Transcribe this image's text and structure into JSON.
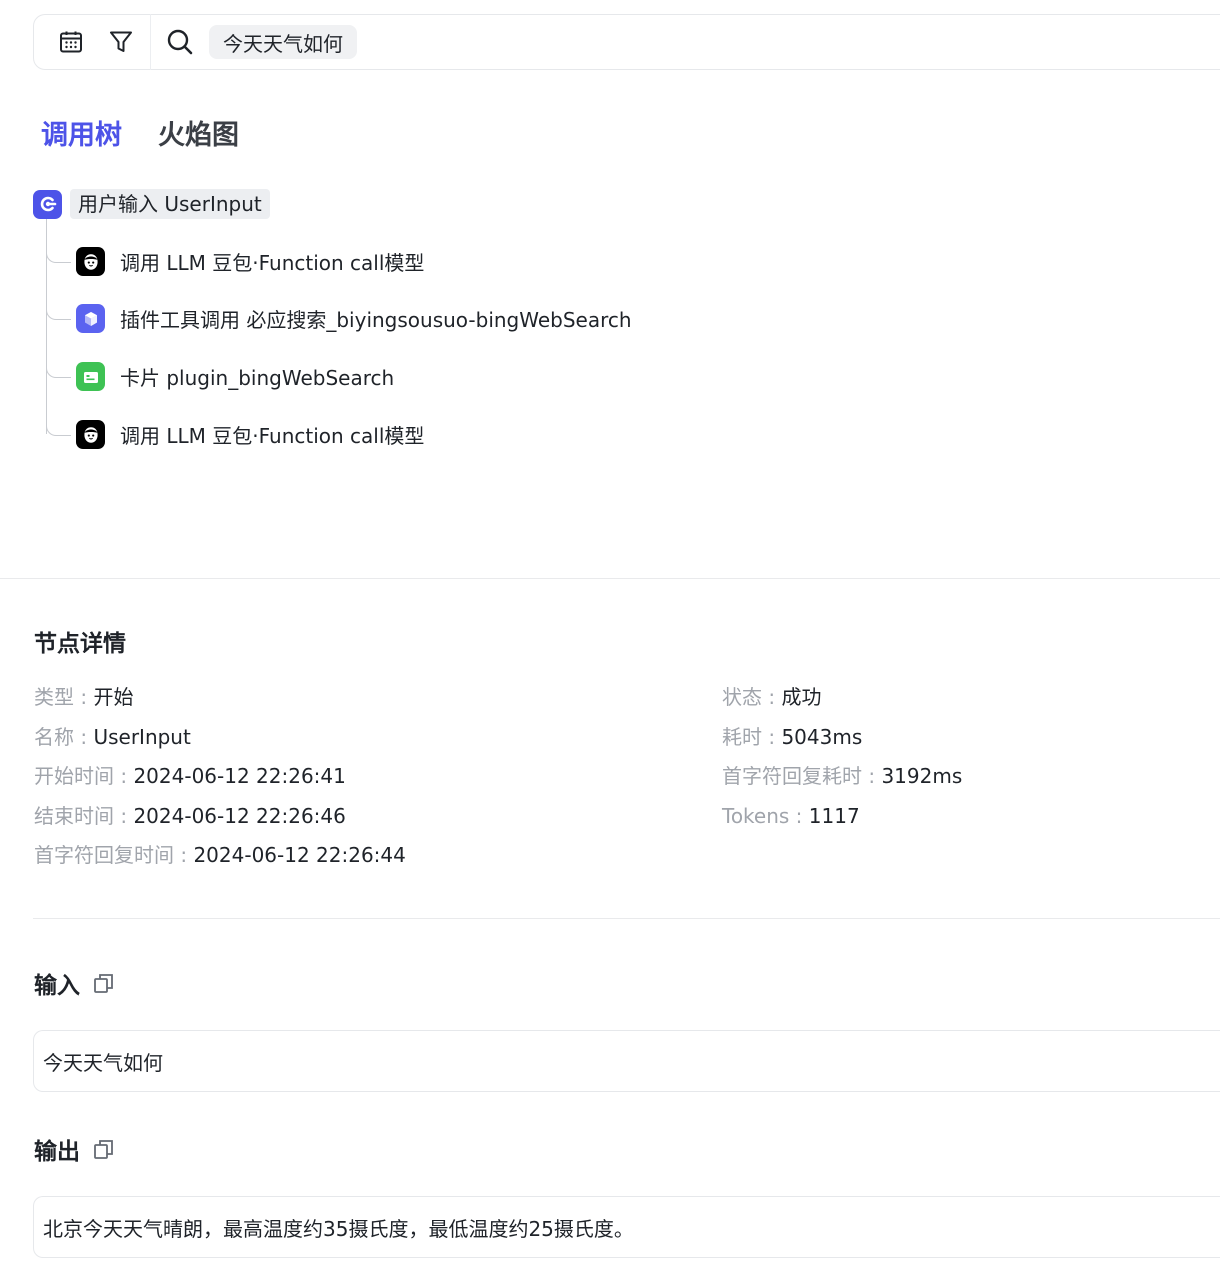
{
  "toolbar": {
    "calendar_icon": "calendar-icon",
    "filter_icon": "filter-icon",
    "search_icon": "search-icon",
    "query": "今天天气如何"
  },
  "tabs": [
    {
      "label": "调用树",
      "active": true
    },
    {
      "label": "火焰图",
      "active": false
    }
  ],
  "tree": {
    "root": {
      "label": "用户输入 UserInput",
      "icon": "start-node-icon",
      "color": "#4d53e8"
    },
    "children": [
      {
        "label": "调用 LLM 豆包·Function call模型",
        "icon": "doubao-llm-icon",
        "color": "#000000"
      },
      {
        "label": "插件工具调用 必应搜索_biyingsousuo-bingWebSearch",
        "icon": "plugin-cube-icon",
        "color": "#5b63f0"
      },
      {
        "label": "卡片 plugin_bingWebSearch",
        "icon": "card-icon",
        "color": "#3ec254"
      },
      {
        "label": "调用 LLM 豆包·Function call模型",
        "icon": "doubao-llm-icon",
        "color": "#000000"
      }
    ]
  },
  "details": {
    "title": "节点详情",
    "left": [
      {
        "key": "类型 : ",
        "value": "开始"
      },
      {
        "key": "名称 : ",
        "value": "UserInput"
      },
      {
        "key": "开始时间 : ",
        "value": "2024-06-12 22:26:41"
      },
      {
        "key": "结束时间 : ",
        "value": "2024-06-12 22:26:46"
      },
      {
        "key": "首字符回复时间 : ",
        "value": "2024-06-12 22:26:44"
      }
    ],
    "right": [
      {
        "key": "状态 : ",
        "value": "成功"
      },
      {
        "key": "耗时 : ",
        "value": "5043ms"
      },
      {
        "key": "首字符回复耗时 : ",
        "value": "3192ms"
      },
      {
        "key": "Tokens : ",
        "value": "1117"
      }
    ]
  },
  "input": {
    "title": "输入",
    "value": "今天天气如何"
  },
  "output": {
    "title": "输出",
    "value": "北京今天天气晴朗，最高温度约35摄氏度，最低温度约25摄氏度。"
  }
}
